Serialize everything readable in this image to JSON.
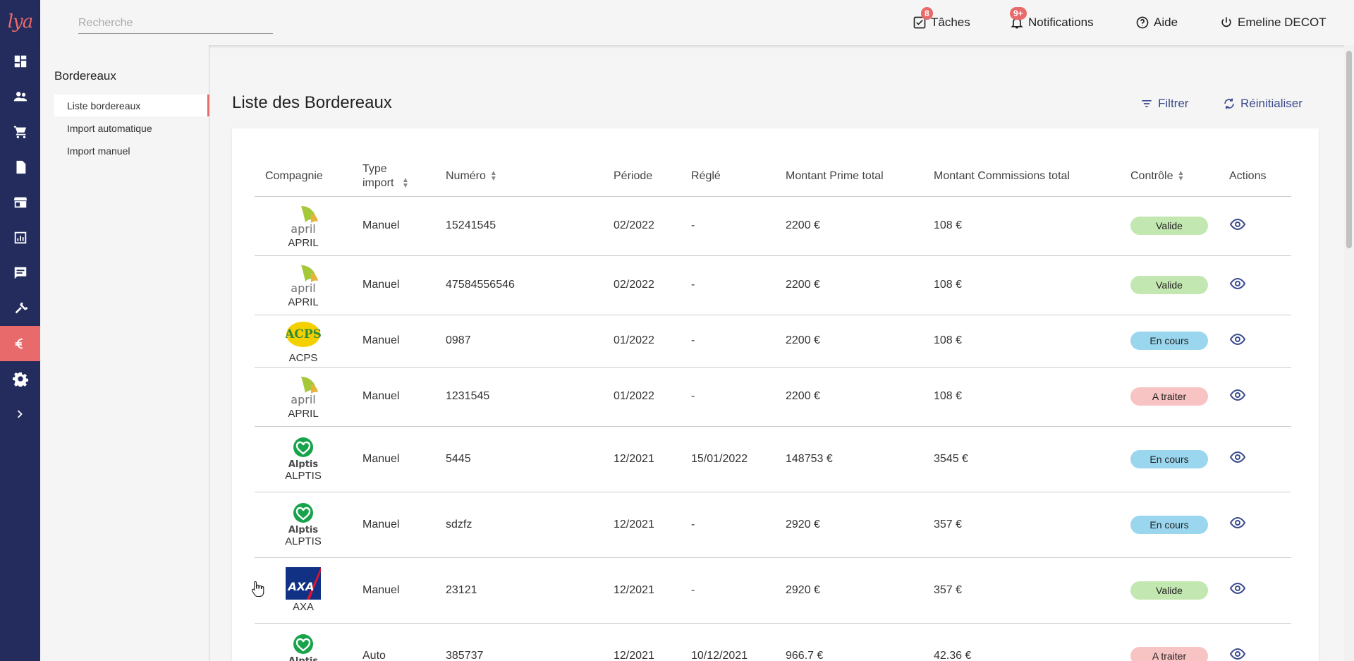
{
  "app": {
    "logo_text": "lya",
    "accent": "#e96a6a",
    "rail_color": "#232c5c"
  },
  "rail": {
    "items": [
      {
        "icon": "dashboard-icon"
      },
      {
        "icon": "people-icon"
      },
      {
        "icon": "cart-icon"
      },
      {
        "icon": "document-icon"
      },
      {
        "icon": "store-icon"
      },
      {
        "icon": "chart-icon"
      },
      {
        "icon": "chat-icon"
      },
      {
        "icon": "tools-icon"
      },
      {
        "icon": "euro-icon",
        "active": true
      },
      {
        "icon": "gear-icon"
      },
      {
        "icon": "chevron-right-icon"
      }
    ]
  },
  "topbar": {
    "search_placeholder": "Recherche",
    "tasks_label": "Tâches",
    "tasks_count": "8",
    "notifications_label": "Notifications",
    "notifications_count": "9+",
    "help_label": "Aide",
    "user_label": "Emeline DECOT"
  },
  "subnav": {
    "title": "Bordereaux",
    "items": [
      "Liste bordereaux",
      "Import automatique",
      "Import manuel"
    ]
  },
  "main": {
    "title": "Liste des Bordereaux",
    "filter_label": "Filtrer",
    "reset_label": "Réinitialiser"
  },
  "table": {
    "columns": [
      "Compagnie",
      "Type import",
      "Numéro",
      "Période",
      "Réglé",
      "Montant Prime total",
      "Montant Commissions total",
      "Contrôle",
      "Actions"
    ],
    "rows": [
      {
        "company": "APRIL",
        "type": "Manuel",
        "numero": "15241545",
        "periode": "02/2022",
        "regle": "-",
        "prime": "2200 €",
        "commissions": "108 €",
        "controle": "Valide"
      },
      {
        "company": "APRIL",
        "type": "Manuel",
        "numero": "47584556546",
        "periode": "02/2022",
        "regle": "-",
        "prime": "2200 €",
        "commissions": "108 €",
        "controle": "Valide"
      },
      {
        "company": "ACPS",
        "type": "Manuel",
        "numero": "0987",
        "periode": "01/2022",
        "regle": "-",
        "prime": "2200 €",
        "commissions": "108 €",
        "controle": "En cours"
      },
      {
        "company": "APRIL",
        "type": "Manuel",
        "numero": "1231545",
        "periode": "01/2022",
        "regle": "-",
        "prime": "2200 €",
        "commissions": "108 €",
        "controle": "A traiter"
      },
      {
        "company": "ALPTIS",
        "type": "Manuel",
        "numero": "5445",
        "periode": "12/2021",
        "regle": "15/01/2022",
        "prime": "148753 €",
        "commissions": "3545 €",
        "controle": "En cours"
      },
      {
        "company": "ALPTIS",
        "type": "Manuel",
        "numero": "sdzfz",
        "periode": "12/2021",
        "regle": "-",
        "prime": "2920 €",
        "commissions": "357 €",
        "controle": "En cours"
      },
      {
        "company": "AXA",
        "type": "Manuel",
        "numero": "23121",
        "periode": "12/2021",
        "regle": "-",
        "prime": "2920 €",
        "commissions": "357 €",
        "controle": "Valide"
      },
      {
        "company": "ALPTIS",
        "type": "Auto",
        "numero": "385737",
        "periode": "12/2021",
        "regle": "10/12/2021",
        "prime": "966.7 €",
        "commissions": "42.36 €",
        "controle": "A traiter"
      }
    ]
  }
}
